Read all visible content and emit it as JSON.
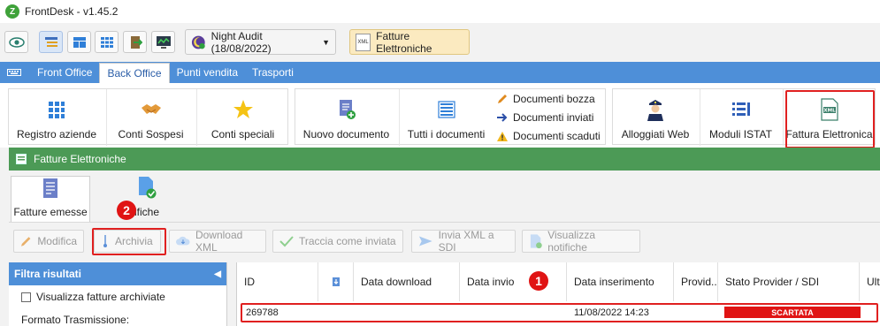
{
  "app": {
    "title": "FrontDesk - v1.45.2",
    "logo_letter": "Z"
  },
  "toolbar": {
    "night_audit": "Night Audit (18/08/2022)",
    "xml_badge": "XML",
    "fatture_button": "Fatture Elettroniche"
  },
  "menu": {
    "tabs": [
      {
        "label": "Front Office"
      },
      {
        "label": "Back Office"
      },
      {
        "label": "Punti vendita"
      },
      {
        "label": "Trasporti"
      }
    ]
  },
  "ribbon": {
    "items": [
      {
        "label": "Registro aziende"
      },
      {
        "label": "Conti Sospesi"
      },
      {
        "label": "Conti speciali"
      },
      {
        "label": "Nuovo documento"
      },
      {
        "label": "Tutti i documenti"
      },
      {
        "label": "Alloggiati Web"
      },
      {
        "label": "Moduli ISTAT"
      },
      {
        "label": "Fattura Elettronica"
      }
    ],
    "small_items": [
      {
        "label": "Documenti bozza"
      },
      {
        "label": "Documenti inviati"
      },
      {
        "label": "Documenti scaduti"
      }
    ],
    "xml_icon_text": "XML"
  },
  "window": {
    "title": "Fatture Elettroniche",
    "tabs": [
      {
        "label": "Fatture emesse"
      },
      {
        "label": "ifiche"
      }
    ],
    "actions": [
      {
        "label": "Modifica"
      },
      {
        "label": "Archivia"
      },
      {
        "label": "Download XML"
      },
      {
        "label": "Traccia come inviata"
      },
      {
        "label": "Invia XML a SDI"
      },
      {
        "label": "Visualizza notifiche"
      }
    ]
  },
  "filter": {
    "title": "Filtra risultati",
    "checkbox_label": "Visualizza fatture archiviate",
    "formato_label": "Formato Trasmissione:"
  },
  "grid": {
    "columns": [
      "ID",
      "",
      "Data download",
      "Data invio",
      "Data inserimento",
      "Provid..",
      "Stato Provider / SDI",
      "Ulti"
    ],
    "rows": [
      {
        "id": "269788",
        "data_inserimento": "11/08/2022 14:23",
        "stato": "SCARTATA"
      }
    ]
  },
  "annotations": {
    "badge1": "1",
    "badge2": "2"
  },
  "colors": {
    "accent_blue": "#4e8fd8",
    "window_green": "#4c9a56",
    "highlight_red": "#e02020",
    "status_red": "#e01414"
  }
}
